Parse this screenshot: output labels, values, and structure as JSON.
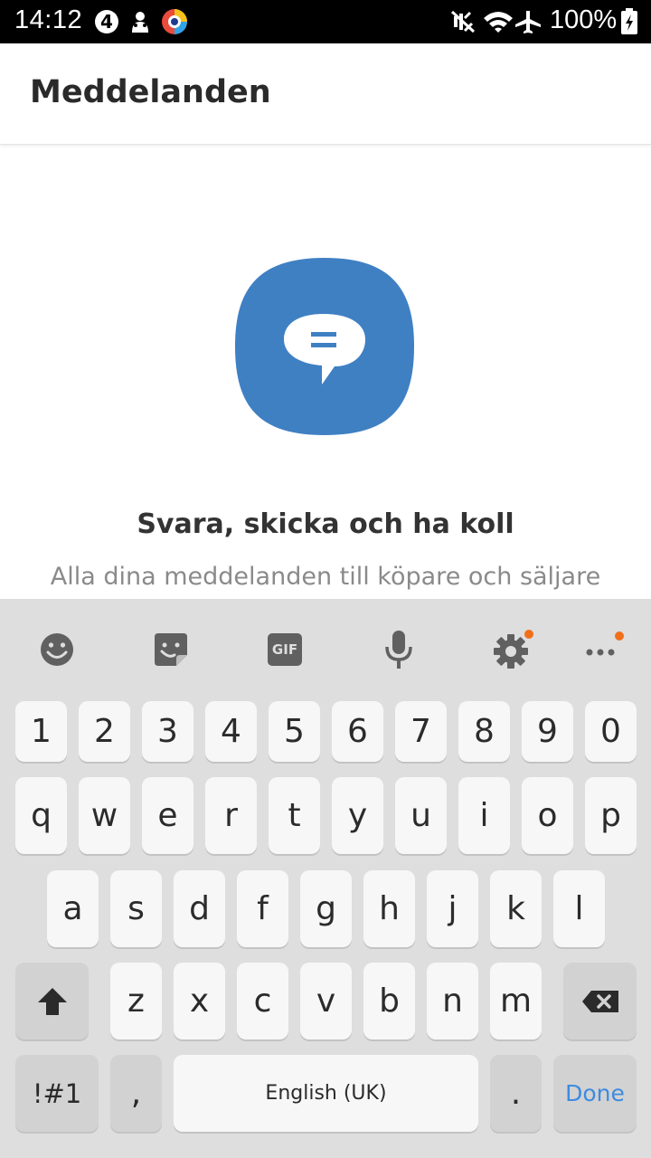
{
  "status_bar": {
    "time": "14:12",
    "battery": "100%",
    "icons": [
      "notification-4-icon",
      "mascot-icon",
      "browser-icon",
      "mute-icon",
      "wifi-icon",
      "airplane-icon",
      "battery-charging-icon"
    ]
  },
  "app_bar": {
    "title": "Meddelanden"
  },
  "empty_state": {
    "title": "Svara, skicka och ha koll",
    "subtitle": "Alla dina meddelanden till köpare och säljare",
    "illustration_color": "#3f80c3"
  },
  "keyboard": {
    "toolbar": [
      "emoji-icon",
      "sticker-icon",
      "gif-icon",
      "microphone-icon",
      "settings-icon",
      "more-icon"
    ],
    "gif_label": "GIF",
    "number_row": [
      "1",
      "2",
      "3",
      "4",
      "5",
      "6",
      "7",
      "8",
      "9",
      "0"
    ],
    "row1": [
      "q",
      "w",
      "e",
      "r",
      "t",
      "y",
      "u",
      "i",
      "o",
      "p"
    ],
    "row2": [
      "a",
      "s",
      "d",
      "f",
      "g",
      "h",
      "j",
      "k",
      "l"
    ],
    "row3": [
      "z",
      "x",
      "c",
      "v",
      "b",
      "n",
      "m"
    ],
    "symbols_label": "!#1",
    "comma_label": ",",
    "space_label": "English (UK)",
    "period_label": ".",
    "done_label": "Done",
    "accent_color": "#3d8be0",
    "badge_color": "#f26f1a"
  }
}
